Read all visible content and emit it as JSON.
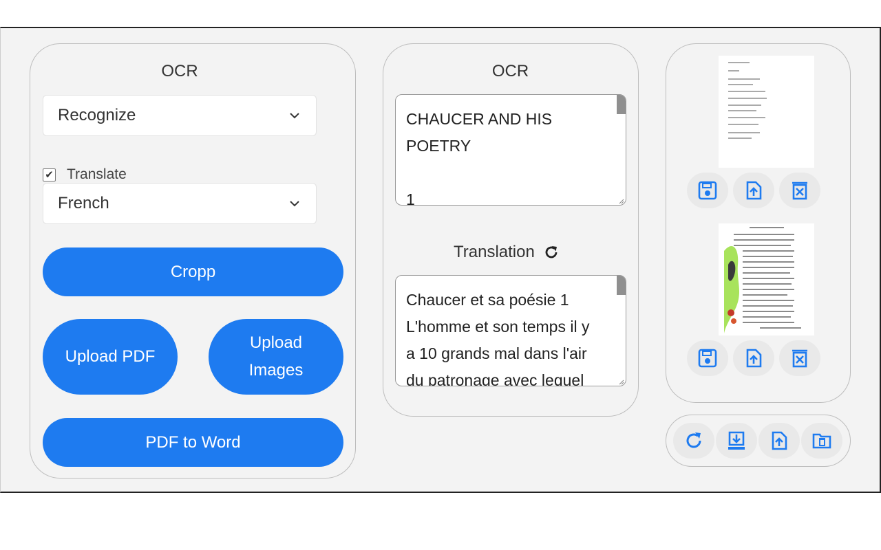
{
  "left_panel": {
    "heading": "OCR",
    "mode_select": {
      "value": "Recognize"
    },
    "translate_checkbox": {
      "label": "Translate",
      "checked": true
    },
    "language_select": {
      "value": "French"
    },
    "buttons": {
      "cropp": "Cropp",
      "upload_pdf": "Upload PDF",
      "upload_images_line1": "Upload",
      "upload_images_line2": "Images",
      "pdf_to_word": "PDF to Word"
    }
  },
  "middle_panel": {
    "heading": "OCR",
    "ocr_text": "CHAUCER AND HIS\nPOETRY\n\n1",
    "translation_heading": "Translation",
    "translation_text": "Chaucer et sa poésie 1\nL'homme et son temps il y\na 10 grands mal dans l'air\ndu patronage avec lequel"
  },
  "right_panel": {
    "pages": [
      {
        "name": "page-1",
        "actions": [
          "save-icon",
          "upload-icon",
          "delete-icon"
        ]
      },
      {
        "name": "page-2",
        "actions": [
          "save-icon",
          "upload-icon",
          "delete-icon"
        ]
      }
    ]
  },
  "toolbar": {
    "icons": [
      "refresh-icon",
      "download-icon",
      "upload-icon",
      "folder-delete-icon"
    ]
  },
  "colors": {
    "accent": "#1e7bf0",
    "icon": "#1e7bf0",
    "panel_bg": "#f3f3f3"
  }
}
